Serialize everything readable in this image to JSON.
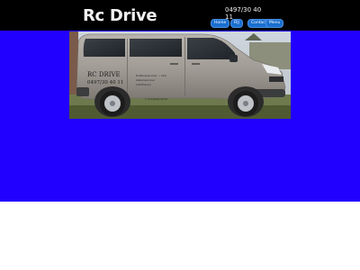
{
  "header": {
    "title": "Rc Drive",
    "phone": "0497/30 40 11",
    "nav": [
      {
        "label": "Home"
      },
      {
        "label": "RIJ"
      },
      {
        "label": "Contact"
      },
      {
        "label": "Menu"
      }
    ]
  },
  "photo": {
    "van_text": {
      "brand": "RC DRIVE",
      "phone": "0497/30 40 11",
      "service_line_1": "Rolstoelvervoer — taxi",
      "service_line_2": "ziekenvervoer",
      "service_line_3": "luchthaven",
      "plate": "rc.drive@skynet.be"
    }
  },
  "colors": {
    "header_bg": "#000000",
    "content_bg": "#2200ff",
    "nav_button": "#1a6fd0"
  }
}
